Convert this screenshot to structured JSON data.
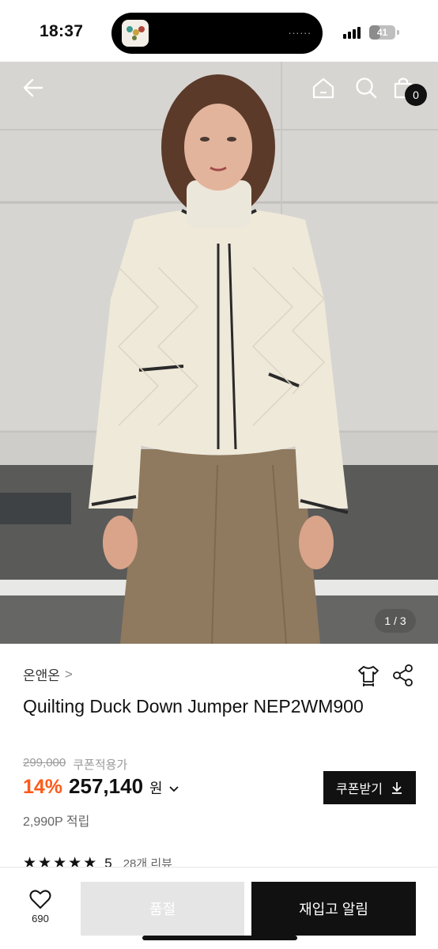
{
  "status_bar": {
    "time": "18:37",
    "island_dots": "......",
    "battery": "41",
    "battery_level": 0.41
  },
  "nav": {
    "back_icon": "back-arrow-icon",
    "home_icon": "home-icon",
    "search_icon": "search-icon",
    "cart_icon": "shopping-bag-icon",
    "cart_count": "0"
  },
  "gallery": {
    "pager": "1 / 3"
  },
  "product": {
    "brand": "온앤온",
    "brand_chevron": ">",
    "title": "Quilting Duck Down Jumper NEP2WM900",
    "original_price": "299,000",
    "coupon_note": "쿠폰적용가",
    "discount": "14%",
    "price": "257,140",
    "currency": "원",
    "currency_chevron": "⌄",
    "points": "2,990P 적립",
    "rating_score": "5",
    "rating_stars": 5,
    "review_count": "28개 리뷰"
  },
  "actions": {
    "coupon_button": "쿠폰받기",
    "like_count": "690",
    "soldout_button": "품절",
    "restock_button": "재입고 알림"
  },
  "colors": {
    "accent": "#ff5a1a",
    "primary": "#111111",
    "disabled": "#e5e5e5"
  }
}
